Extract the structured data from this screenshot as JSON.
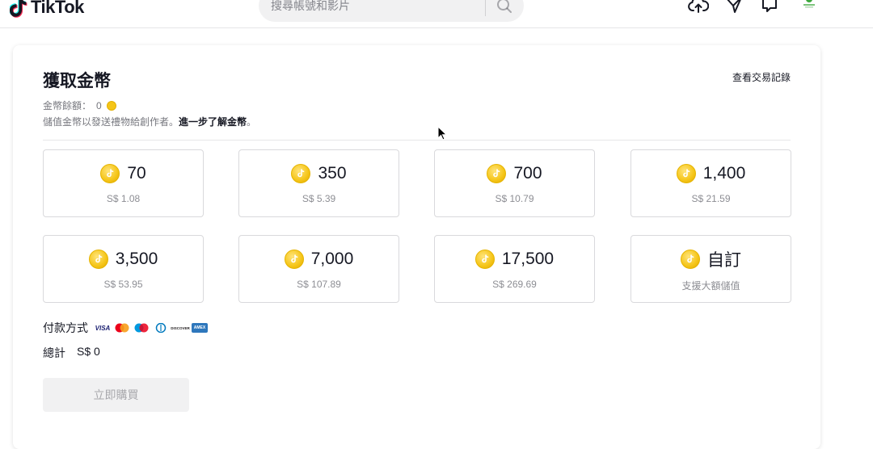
{
  "header": {
    "logo_text": "TikTok",
    "search_placeholder": "搜尋帳號和影片",
    "icons": [
      "upload-icon",
      "inbox-icon",
      "messages-icon",
      "avatar"
    ],
    "accent_color": "#fe2c55"
  },
  "coins": {
    "title": "獲取金幣",
    "history_link": "查看交易記錄",
    "balance_label": "金幣餘額：",
    "balance_value": "0",
    "description": "儲值金幣以發送禮物給創作者。",
    "learn_more": "進一步了解金幣",
    "learn_more_suffix": "。",
    "packages": [
      {
        "amount": "70",
        "price": "S$ 1.08"
      },
      {
        "amount": "350",
        "price": "S$ 5.39"
      },
      {
        "amount": "700",
        "price": "S$ 10.79"
      },
      {
        "amount": "1,400",
        "price": "S$ 21.59"
      },
      {
        "amount": "3,500",
        "price": "S$ 53.95"
      },
      {
        "amount": "7,000",
        "price": "S$ 107.89"
      },
      {
        "amount": "17,500",
        "price": "S$ 269.69"
      },
      {
        "amount": "自訂",
        "price": "支援大額儲值"
      }
    ],
    "payment_label": "付款方式",
    "payment_cards": [
      {
        "icon": "visa-icon",
        "label": "VISA",
        "color": "#1a1f71"
      },
      {
        "icon": "mastercard-icon",
        "label": "",
        "color": "#eb001b"
      },
      {
        "icon": "maestro-icon",
        "label": "",
        "color": "#0099df"
      },
      {
        "icon": "diners-icon",
        "label": "",
        "color": "#0079be"
      },
      {
        "icon": "discover-icon",
        "label": "DISCOVER",
        "color": "#ff6000"
      },
      {
        "icon": "amex-icon",
        "label": "AMEX",
        "color": "#2e77bc"
      }
    ],
    "total_label": "總計",
    "total_value": "S$ 0",
    "buy_button": "立即購買",
    "coin_color": "#f5c518"
  }
}
